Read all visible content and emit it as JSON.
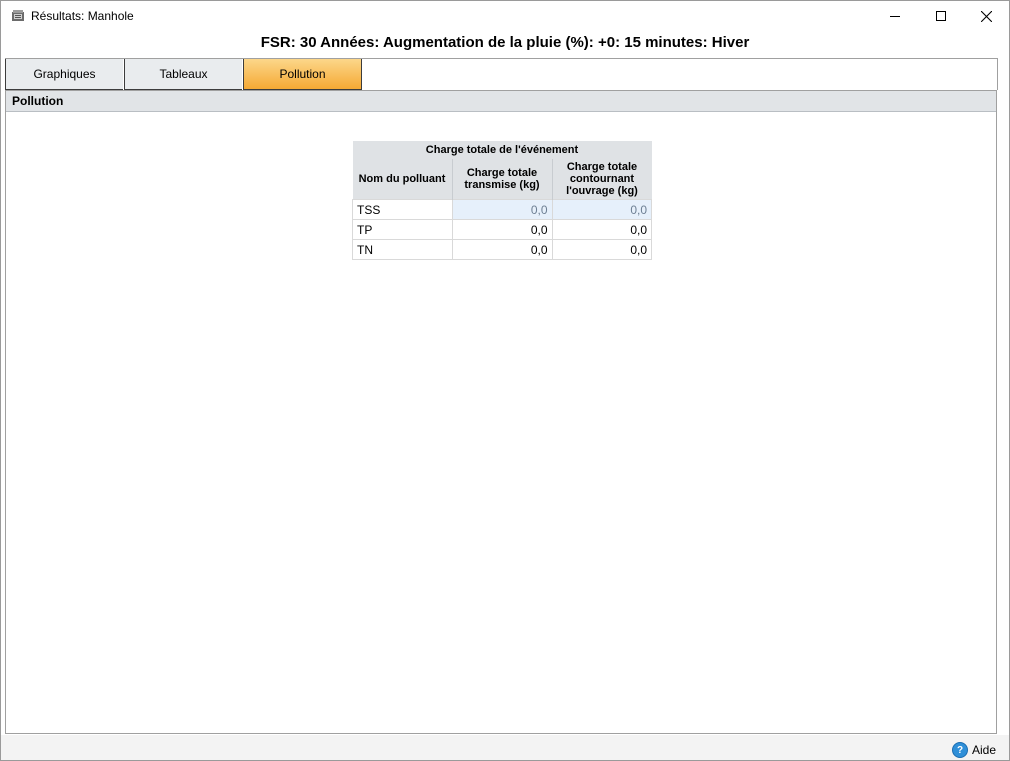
{
  "window": {
    "title": "Résultats: Manhole"
  },
  "header": {
    "text": "FSR: 30 Années: Augmentation de la pluie (%): +0: 15 minutes: Hiver"
  },
  "tabs": [
    {
      "label": "Graphiques",
      "active": false
    },
    {
      "label": "Tableaux",
      "active": false
    },
    {
      "label": "Pollution",
      "active": true
    }
  ],
  "panel": {
    "title": "Pollution"
  },
  "table": {
    "group_header": "Charge totale de l'événement",
    "columns": [
      "Nom du polluant",
      "Charge totale transmise (kg)",
      "Charge totale contournant l'ouvrage (kg)"
    ],
    "rows": [
      {
        "name": "TSS",
        "transmise": "0,0",
        "contournant": "0,0"
      },
      {
        "name": "TP",
        "transmise": "0,0",
        "contournant": "0,0"
      },
      {
        "name": "TN",
        "transmise": "0,0",
        "contournant": "0,0"
      }
    ]
  },
  "footer": {
    "help_label": "Aide"
  },
  "colors": {
    "active_tab": "#f5a934",
    "selected_row": "#e6f0fb",
    "help_icon": "#2f8fd8"
  }
}
